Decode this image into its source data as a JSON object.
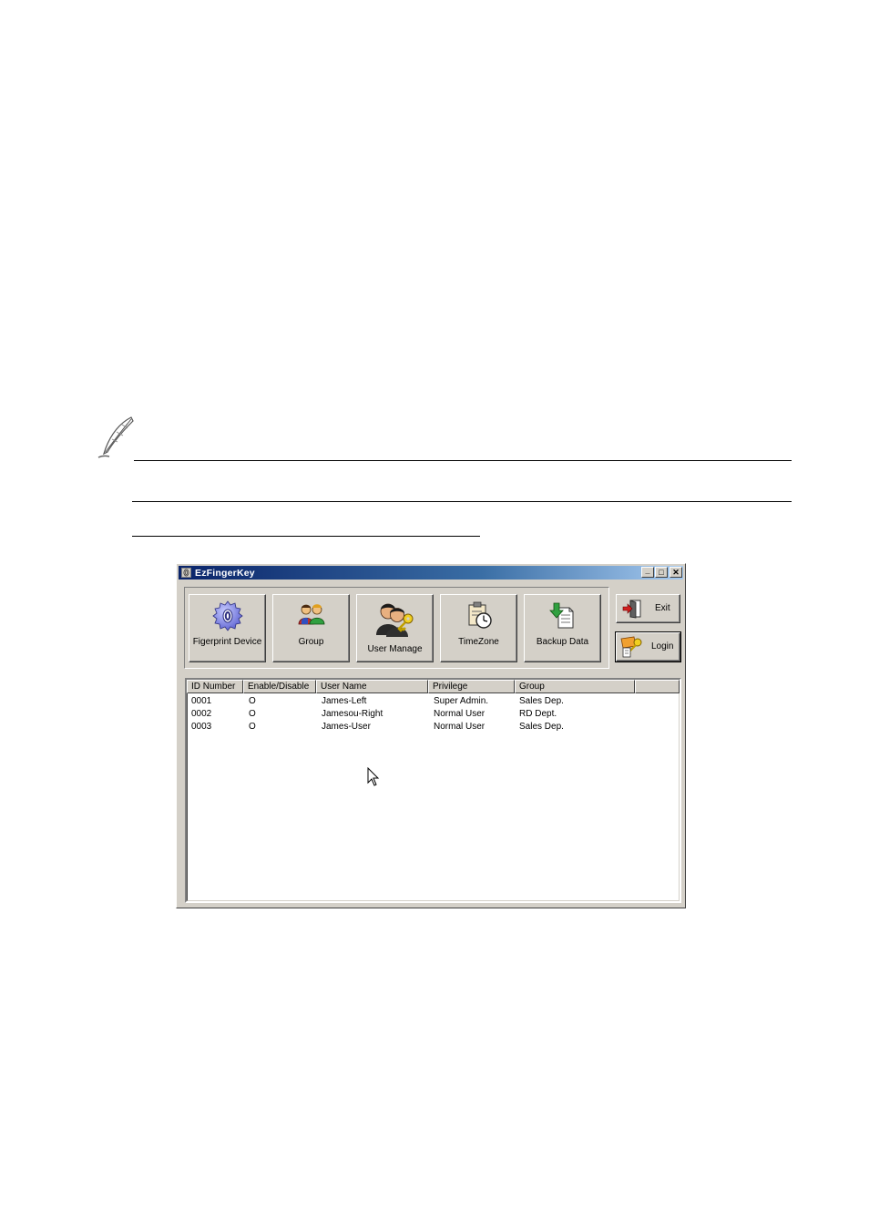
{
  "window": {
    "title": "EzFingerKey",
    "caption": {
      "minimize": "_",
      "maximize": "□",
      "close": "✕"
    }
  },
  "toolbar": {
    "buttons": [
      {
        "label": "Figerprint Device",
        "icon": "gear-icon"
      },
      {
        "label": "Group",
        "icon": "group-people-icon"
      },
      {
        "label": "User Manage",
        "icon": "user-key-icon"
      },
      {
        "label": "TimeZone",
        "icon": "clock-clipboard-icon"
      },
      {
        "label": "Backup Data",
        "icon": "backup-download-icon"
      }
    ],
    "exit_label": "Exit",
    "login_label": "Login"
  },
  "table": {
    "columns": [
      "ID Number",
      "Enable/Disable",
      "User Name",
      "Privilege",
      "Group",
      ""
    ],
    "rows": [
      [
        "0001",
        "O",
        "James-Left",
        "Super Admin.",
        "Sales Dep."
      ],
      [
        "0002",
        "O",
        "Jamesou-Right",
        "Normal User",
        "RD Dept."
      ],
      [
        "0003",
        "O",
        "James-User",
        "Normal User",
        "Sales Dep."
      ]
    ]
  },
  "colors": {
    "title_start": "#0a246a",
    "title_end": "#a6caf0",
    "face": "#d4d0c8"
  }
}
